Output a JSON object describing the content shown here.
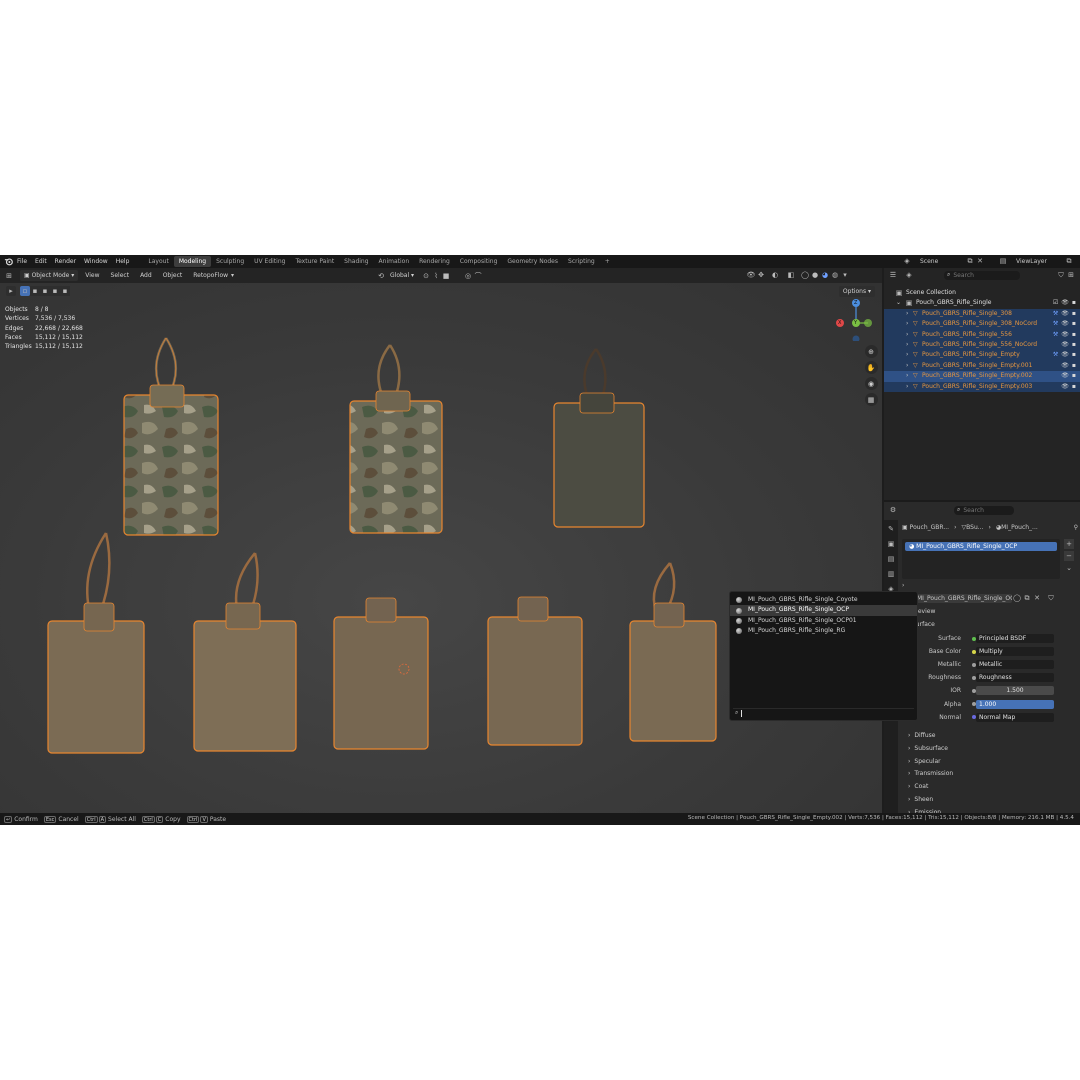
{
  "menus": [
    "File",
    "Edit",
    "Render",
    "Window",
    "Help"
  ],
  "workspaces": [
    {
      "label": "Layout",
      "active": false
    },
    {
      "label": "Modeling",
      "active": true
    },
    {
      "label": "Sculpting",
      "active": false
    },
    {
      "label": "UV Editing",
      "active": false
    },
    {
      "label": "Texture Paint",
      "active": false
    },
    {
      "label": "Shading",
      "active": false
    },
    {
      "label": "Animation",
      "active": false
    },
    {
      "label": "Rendering",
      "active": false
    },
    {
      "label": "Compositing",
      "active": false
    },
    {
      "label": "Geometry Nodes",
      "active": false
    },
    {
      "label": "Scripting",
      "active": false
    }
  ],
  "add_workspace": "+",
  "scene": {
    "name": "Scene",
    "view_layer": "ViewLayer"
  },
  "viewport_header": {
    "mode": "Object Mode",
    "menus": [
      "View",
      "Select",
      "Add",
      "Object",
      "RetopoFlow"
    ],
    "orientation": "Global",
    "options": "Options"
  },
  "stats": [
    {
      "label": "Objects",
      "value": "8 / 8"
    },
    {
      "label": "Vertices",
      "value": "7,536 / 7,536"
    },
    {
      "label": "Edges",
      "value": "22,668 / 22,668"
    },
    {
      "label": "Faces",
      "value": "15,112 / 15,112"
    },
    {
      "label": "Triangles",
      "value": "15,112 / 15,112"
    }
  ],
  "gizmo": {
    "x": "X",
    "y": "Y",
    "z": "Z"
  },
  "outliner": {
    "search_placeholder": "Search",
    "scene_collection": "Scene Collection",
    "collection": "Pouch_GBRS_Rifle_Single",
    "objects": [
      {
        "name": "Pouch_GBRS_Rifle_Single_308",
        "state": "sel"
      },
      {
        "name": "Pouch_GBRS_Rifle_Single_308_NoCord",
        "state": "sel"
      },
      {
        "name": "Pouch_GBRS_Rifle_Single_556",
        "state": "sel"
      },
      {
        "name": "Pouch_GBRS_Rifle_Single_556_NoCord",
        "state": "sel"
      },
      {
        "name": "Pouch_GBRS_Rifle_Single_Empty",
        "state": "sel"
      },
      {
        "name": "Pouch_GBRS_Rifle_Single_Empty.001",
        "state": "sel"
      },
      {
        "name": "Pouch_GBRS_Rifle_Single_Empty.002",
        "state": "act"
      },
      {
        "name": "Pouch_GBRS_Rifle_Single_Empty.003",
        "state": "sel"
      }
    ]
  },
  "properties": {
    "search_placeholder": "Search",
    "breadcrumb": [
      "Pouch_GBR...",
      "BSu...",
      "MI_Pouch_..."
    ],
    "slot": "MI_Pouch_GBRS_Rifle_Single_OCP",
    "material_field": "MI_Pouch_GBRS_Rifle_Single_OCP",
    "panels": {
      "preview": "Preview",
      "surface": "Surface"
    },
    "rows": [
      {
        "label": "Surface",
        "value": "Principled BSDF",
        "dot": "#5fbf4e",
        "kind": "field"
      },
      {
        "label": "Base Color",
        "value": "Multiply",
        "dot": "#d6d64a",
        "kind": "field"
      },
      {
        "label": "Metallic",
        "value": "Metallic",
        "dot": "#9e9e9e",
        "kind": "field"
      },
      {
        "label": "Roughness",
        "value": "Roughness",
        "dot": "#9e9e9e",
        "kind": "field"
      },
      {
        "label": "IOR",
        "value": "1.500",
        "dot": "#9e9e9e",
        "kind": "num"
      },
      {
        "label": "Alpha",
        "value": "1.000",
        "dot": "#9e9e9e",
        "kind": "blue"
      },
      {
        "label": "Normal",
        "value": "Normal Map",
        "dot": "#6a6ae0",
        "kind": "field"
      }
    ],
    "subpanels": [
      "Diffuse",
      "Subsurface",
      "Specular",
      "Transmission",
      "Coat",
      "Sheen",
      "Emission"
    ]
  },
  "material_dropdown": {
    "items": [
      {
        "label": "MI_Pouch_GBRS_Rifle_Single_Coyote",
        "highlight": false
      },
      {
        "label": "MI_Pouch_GBRS_Rifle_Single_OCP",
        "highlight": true
      },
      {
        "label": "MI_Pouch_GBRS_Rifle_Single_OCP01",
        "highlight": false
      },
      {
        "label": "MI_Pouch_GBRS_Rifle_Single_RG",
        "highlight": false
      }
    ],
    "search_value": ""
  },
  "statusbar": {
    "left": [
      {
        "keys": [
          "↵"
        ],
        "label": "Confirm"
      },
      {
        "keys": [
          "Esc"
        ],
        "label": "Cancel"
      },
      {
        "keys": [
          "Ctrl",
          "A"
        ],
        "label": "Select All"
      },
      {
        "keys": [
          "Ctrl",
          "C"
        ],
        "label": "Copy"
      },
      {
        "keys": [
          "Ctrl",
          "V"
        ],
        "label": "Paste"
      }
    ],
    "right": "Scene Collection | Pouch_GBRS_Rifle_Single_Empty.002 | Verts:7,536 | Faces:15,112 | Tris:15,112 | Objects:8/8 | Memory: 216.1 MB | 4.5.4"
  },
  "colors": {
    "selection_outline": "#e8862f",
    "object_name": "#e8973f",
    "active_row": "#2f5186",
    "selected_row": "#223a5e",
    "accent_blue": "#4672b6"
  }
}
